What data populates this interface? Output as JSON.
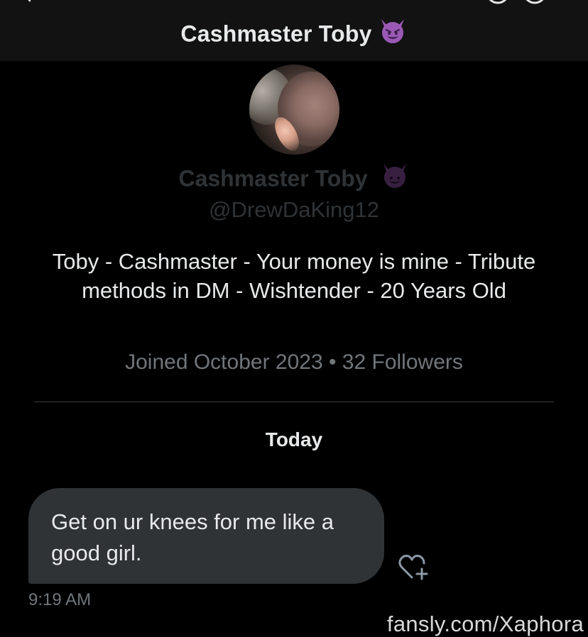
{
  "header": {
    "title": "Cashmaster Toby",
    "title_emoji": "😈",
    "back_icon": "back-arrow-icon",
    "call_icon": "phone-icon",
    "info_icon": "info-icon"
  },
  "profile": {
    "name": "Cashmaster Toby",
    "name_emoji": "😈",
    "handle": "@DrewDaKing12",
    "bio": "Toby - Cashmaster - Your money is mine - Tribute methods in DM - Wishtender - 20 Years Old",
    "meta": "Joined October 2023 • 32 Followers"
  },
  "conversation": {
    "day_label": "Today",
    "messages": [
      {
        "text": "Get on ur knees for me like a good girl.",
        "time": "9:19 AM",
        "react_icon": "heart-plus-icon"
      }
    ]
  },
  "watermark": "fansly.com/Xaphora",
  "colors": {
    "background": "#000000",
    "header_bg": "#121212",
    "bubble_bg": "#2f3336",
    "text_primary": "#e7e9ea",
    "text_secondary": "#71767b",
    "devil_emoji": "#9b59b6"
  }
}
